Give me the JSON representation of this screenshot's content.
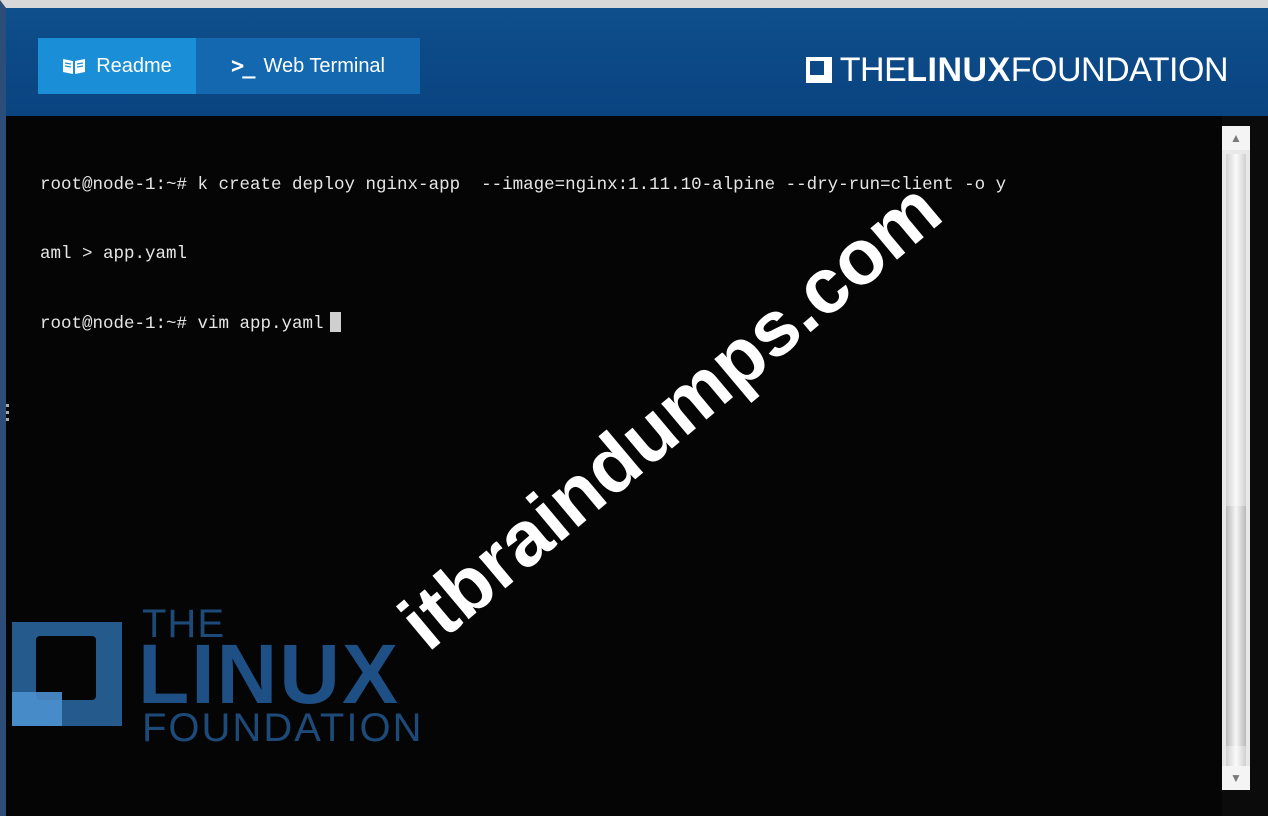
{
  "header": {
    "tabs": [
      {
        "label": "Readme",
        "icon": "book-icon"
      },
      {
        "label": "Web Terminal",
        "icon": "terminal-prompt-icon",
        "glyph": ">_"
      }
    ],
    "brand": {
      "part1": "THE",
      "part2": "LINUX",
      "part3": "FOUNDATION"
    }
  },
  "terminal": {
    "lines": [
      "root@node-1:~# k create deploy nginx-app  --image=nginx:1.11.10-alpine --dry-run=client -o y",
      "aml > app.yaml",
      "root@node-1:~# vim app.yaml"
    ]
  },
  "background_logo": {
    "the": "THE",
    "linux": "LINUX",
    "foundation": "FOUNDATION"
  },
  "watermark": {
    "text": "itbraindumps.com"
  },
  "colors": {
    "header_bg": "#0e4f8c",
    "tab_readme": "#1a8fd8",
    "tab_terminal": "#1368b0",
    "terminal_bg": "#050505",
    "terminal_text": "#e6e6e6"
  }
}
